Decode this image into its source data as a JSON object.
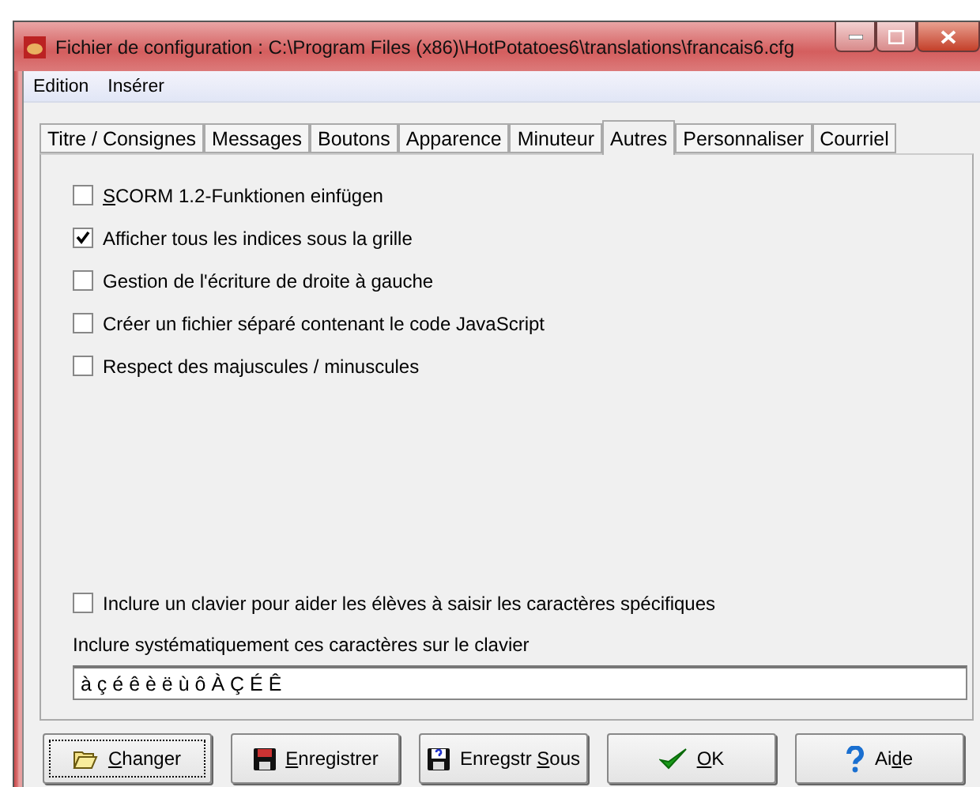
{
  "window": {
    "title": "Fichier de configuration : C:\\Program Files (x86)\\HotPotatoes6\\translations\\francais6.cfg"
  },
  "menu": [
    "Edition",
    "Insérer"
  ],
  "tabs": [
    {
      "label": "Titre / Consignes",
      "selected": false
    },
    {
      "label": "Messages",
      "selected": false
    },
    {
      "label": "Boutons",
      "selected": false
    },
    {
      "label": "Apparence",
      "selected": false
    },
    {
      "label": "Minuteur",
      "selected": false
    },
    {
      "label": "Autres",
      "selected": true
    },
    {
      "label": "Personnaliser",
      "selected": false
    },
    {
      "label": "Courriel",
      "selected": false
    }
  ],
  "options": [
    {
      "label": {
        "key": "S",
        "after": "CORM 1.2-Funktionen einfügen"
      },
      "checked": false
    },
    {
      "label": {
        "before": "Afficher tous les indices sous la grille"
      },
      "checked": true
    },
    {
      "label": {
        "before": "Gestion de l'écriture de droite à gauche"
      },
      "checked": false
    },
    {
      "label": {
        "before": "Créer un fichier séparé contenant le code JavaScript"
      },
      "checked": false
    },
    {
      "label": {
        "before": "Respect des majuscules / minuscules"
      },
      "checked": false
    }
  ],
  "keyboard_option": {
    "label": {
      "before": "Inclure un clavier pour aider les élèves à saisir les caractères spécifiques"
    },
    "checked": false
  },
  "characters": {
    "label": "Inclure systématiquement ces caractères sur le clavier",
    "value": "à ç é ê è ë ù ô À Ç É Ê"
  },
  "buttons": [
    {
      "kind": "folder",
      "label": {
        "key": "C",
        "after": "hanger"
      },
      "focused": true
    },
    {
      "kind": "save",
      "label": {
        "key": "E",
        "after": "nregistrer"
      },
      "focused": false
    },
    {
      "kind": "saveas",
      "label": {
        "before": "Enregstr ",
        "key": "S",
        "after": "ous"
      },
      "focused": false
    },
    {
      "kind": "ok",
      "label": {
        "key": "O",
        "after": "K"
      },
      "focused": false
    },
    {
      "kind": "help",
      "label": {
        "before": "Ai",
        "key": "d",
        "after": "e"
      },
      "focused": false
    }
  ]
}
